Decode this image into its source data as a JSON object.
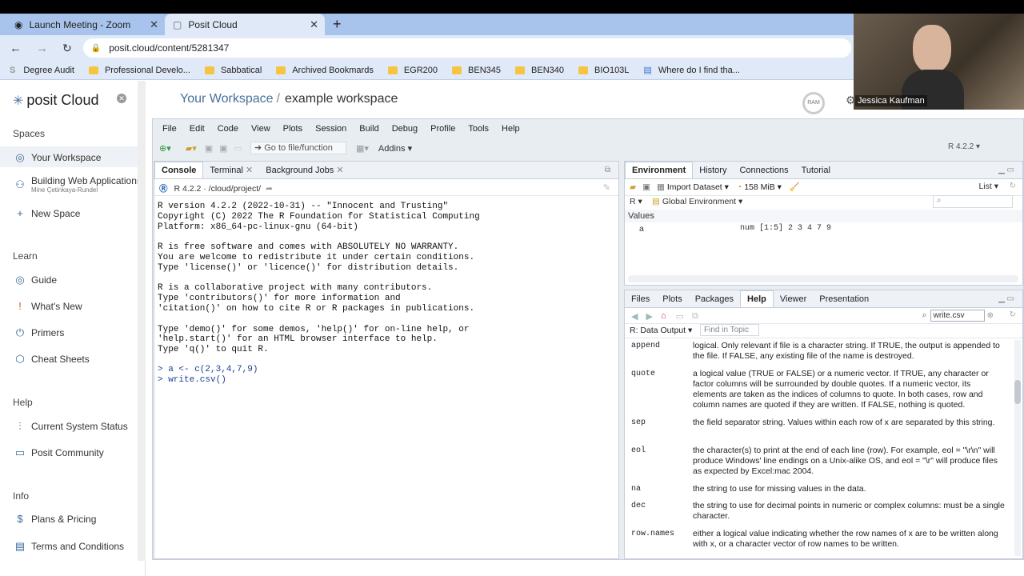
{
  "browser": {
    "tabs": [
      {
        "title": "Launch Meeting - Zoom"
      },
      {
        "title": "Posit Cloud"
      }
    ],
    "url": "posit.cloud/content/5281347",
    "bookmarks": [
      "Degree Audit",
      "Professional Develo...",
      "Sabbatical",
      "Archived Bookmards",
      "EGR200",
      "BEN345",
      "BEN340",
      "BIO103L",
      "Where do I find tha..."
    ]
  },
  "sidebar": {
    "logo": "posit Cloud",
    "spaces_header": "Spaces",
    "spaces": [
      {
        "label": "Your Workspace"
      },
      {
        "label": "Building Web Applications",
        "sub": "Mine Çetinkaya-Rundel"
      },
      {
        "label": "New Space"
      }
    ],
    "learn_header": "Learn",
    "learn": [
      "Guide",
      "What's New",
      "Primers",
      "Cheat Sheets"
    ],
    "help_header": "Help",
    "help": [
      "Current System Status",
      "Posit Community"
    ],
    "info_header": "Info",
    "info": [
      "Plans & Pricing",
      "Terms and Conditions"
    ]
  },
  "workspace": {
    "crumb": "Your Workspace",
    "sep": "/",
    "name": "example workspace",
    "ram": "RAM",
    "user": "Jessica Kaufman"
  },
  "rstudio": {
    "menu": [
      "File",
      "Edit",
      "Code",
      "View",
      "Plots",
      "Session",
      "Build",
      "Debug",
      "Profile",
      "Tools",
      "Help"
    ],
    "goto": "Go to file/function",
    "addins": "Addins",
    "version": "R 4.2.2",
    "console_tabs": [
      "Console",
      "Terminal",
      "Background Jobs"
    ],
    "console_path": "R 4.2.2 · /cloud/project/",
    "console_text": "R version 4.2.2 (2022-10-31) -- \"Innocent and Trusting\"\nCopyright (C) 2022 The R Foundation for Statistical Computing\nPlatform: x86_64-pc-linux-gnu (64-bit)\n\nR is free software and comes with ABSOLUTELY NO WARRANTY.\nYou are welcome to redistribute it under certain conditions.\nType 'license()' or 'licence()' for distribution details.\n\nR is a collaborative project with many contributors.\nType 'contributors()' for more information and\n'citation()' on how to cite R or R packages in publications.\n\nType 'demo()' for some demos, 'help()' for on-line help, or\n'help.start()' for an HTML browser interface to help.\nType 'q()' to quit R.",
    "console_input": "> a <- c(2,3,4,7,9)\n> write.csv()",
    "env_tabs": [
      "Environment",
      "History",
      "Connections",
      "Tutorial"
    ],
    "import_dataset": "Import Dataset",
    "memory": "158 MiB",
    "list_view": "List",
    "r_label": "R",
    "global_env": "Global Environment",
    "values_header": "Values",
    "env_var_name": "a",
    "env_var_value": "num [1:5] 2 3 4 7 9",
    "files_tabs": [
      "Files",
      "Plots",
      "Packages",
      "Help",
      "Viewer",
      "Presentation"
    ],
    "help_search": "write.csv",
    "help_topic": "R: Data Output",
    "find_in_topic": "Find in Topic",
    "help_args": [
      {
        "arg": "append",
        "desc": "logical. Only relevant if file is a character string. If TRUE, the output is appended to the file. If FALSE, any existing file of the name is destroyed."
      },
      {
        "arg": "quote",
        "desc": "a logical value (TRUE or FALSE) or a numeric vector. If TRUE, any character or factor columns will be surrounded by double quotes. If a numeric vector, its elements are taken as the indices of columns to quote. In both cases, row and column names are quoted if they are written. If FALSE, nothing is quoted."
      },
      {
        "arg": "sep",
        "desc": "the field separator string. Values within each row of x are separated by this string."
      },
      {
        "arg": "eol",
        "desc": "the character(s) to print at the end of each line (row). For example, eol = \"\\r\\n\" will produce Windows' line endings on a Unix-alike OS, and eol = \"\\r\" will produce files as expected by Excel:mac 2004."
      },
      {
        "arg": "na",
        "desc": "the string to use for missing values in the data."
      },
      {
        "arg": "dec",
        "desc": "the string to use for decimal points in numeric or complex columns: must be a single character."
      },
      {
        "arg": "row.names",
        "desc": "either a logical value indicating whether the row names of x are to be written along with x, or a character vector of row names to be written."
      }
    ]
  }
}
